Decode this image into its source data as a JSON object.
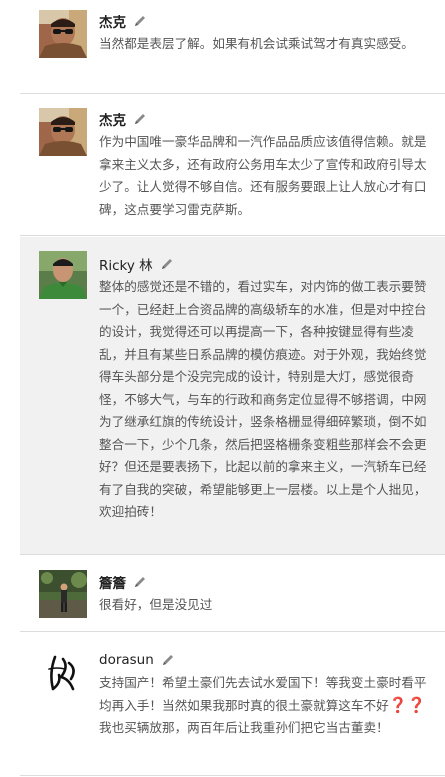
{
  "comments": [
    {
      "author": "杰克",
      "text": "当然都是表层了解。如果有机会试乘试驾才有真实感受。",
      "avatar": "man-with-sunglasses-avatar"
    },
    {
      "author": "杰克",
      "text": "作为中国唯一豪华品牌和一汽作品品质应该值得信赖。就是拿来主义太多，还有政府公务用车太少了宣传和政府引导太少了。让人觉得不够自信。还有服务要跟上让人放心才有口碑，这点要学习雷克萨斯。",
      "avatar": "man-with-sunglasses-avatar"
    },
    {
      "author": "Ricky 林",
      "text": "整体的感觉还是不错的，看过实车，对内饰的做工表示要赞一个，已经赶上合资品牌的高级轿车的水准，但是对中控台的设计，我觉得还可以再提高一下，各种按键显得有些凌乱，并且有某些日系品牌的模仿痕迹。对于外观，我始终觉得车头部分是个没完完成的设计，特别是大灯，感觉很奇怪，不够大气，与车的行政和商务定位显得不够搭调，中网为了继承红旗的传统设计，竖条格栅显得细碎繁琐，倒不如整合一下，少个几条，然后把竖格栅条变粗些那样会不会更好？但还是要表扬下，比起以前的拿来主义，一汽轿车已经有了自我的突破，希望能够更上一层楼。以上是个人拙见，欢迎拍砖！",
      "avatar": "man-in-green-shirt-avatar"
    },
    {
      "author": "簷簷",
      "text": "很看好，但是没见过",
      "avatar": "person-outdoors-avatar"
    },
    {
      "author": "dorasun",
      "text_before": "支持国产！希望土豪们先去试水爱国下！等我变土豪时看平均再入手！当然如果我那时真的很土豪就算这车不好",
      "emoji": "❓❓",
      "text_after": "我也买辆放那，两百年后让我重孙们把它当古董卖！",
      "avatar": "calligraphy-signature-avatar"
    }
  ],
  "edit_icon": "pencil-icon",
  "colors": {
    "author": "#222222",
    "body_text": "#555555",
    "highlight_bg": "#f1f1f1",
    "divider": "#dcdcdc",
    "emoji": "#d42020"
  }
}
